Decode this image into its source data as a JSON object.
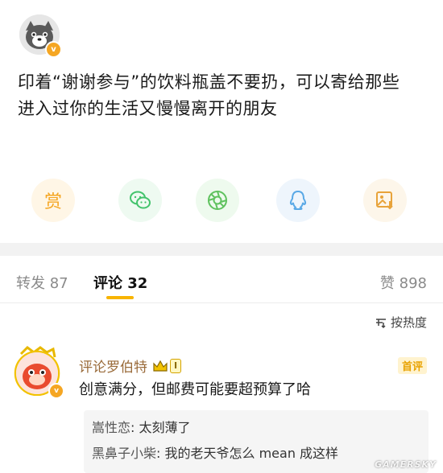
{
  "post": {
    "text_line1": "印着“谢谢参与”的饮料瓶盖不要扔，可以寄给那些",
    "text_line2": "进入过你的生活又慢慢离开的朋友",
    "verified_badge": "v"
  },
  "share": {
    "reward_label": "赏",
    "icons": [
      "reward-icon",
      "wechat-icon",
      "moments-icon",
      "qq-icon",
      "save-image-icon"
    ]
  },
  "tabs": {
    "repost_label": "转发",
    "repost_count": "87",
    "comment_label": "评论",
    "comment_count": "32",
    "like_label": "赞",
    "like_count": "898"
  },
  "sort": {
    "label": "按热度"
  },
  "comment": {
    "username": "评论罗伯特",
    "level": "I",
    "first_badge": "首评",
    "text": "创意满分，但邮费可能要超预算了哈",
    "replies": [
      {
        "name": "嵩性恋",
        "text": "太刻薄了"
      },
      {
        "name": "黑鼻子小柴",
        "text": "我的老天爷怎么 mean 成这样"
      }
    ]
  },
  "watermark": "GAMERSKY",
  "colors": {
    "accent": "#f8b400",
    "reward": "#f5a623",
    "wechat": "#43c36c",
    "moments": "#5fc25e",
    "qq": "#5aa9e6",
    "save": "#e8a33a"
  }
}
